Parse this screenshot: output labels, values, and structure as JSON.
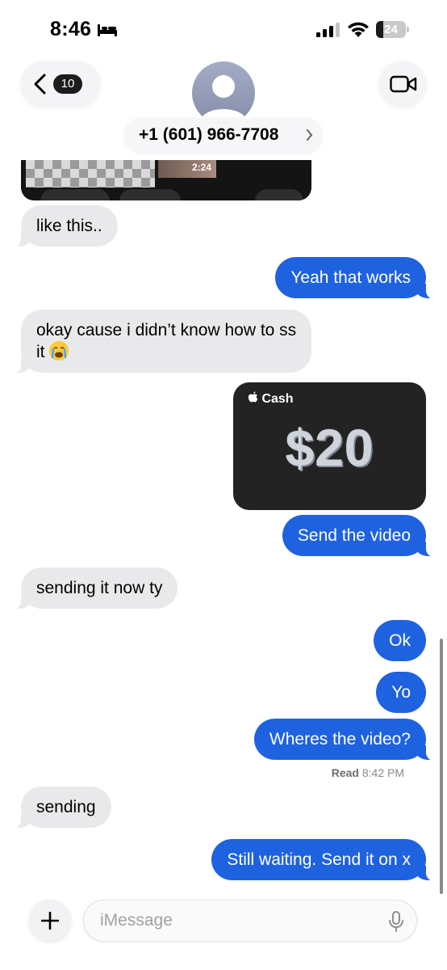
{
  "status_bar": {
    "time": "8:46",
    "battery_level": "24",
    "battery_fraction": 0.24
  },
  "header": {
    "back_count": "10",
    "contact_name": "+1 (601) 966-7708"
  },
  "media": {
    "duration": "2:24"
  },
  "messages": [
    {
      "text": "like this..",
      "direction": "incoming"
    },
    {
      "text": "Yeah that works",
      "direction": "outgoing"
    },
    {
      "line1": "okay cause i didn’t know how to ss",
      "line2": "it",
      "direction": "incoming",
      "emoji": "loudly-crying-face"
    },
    {
      "type": "apple-cash",
      "label": "Cash",
      "amount": "$20",
      "direction": "outgoing"
    },
    {
      "text": "Send the video",
      "direction": "outgoing"
    },
    {
      "text": "sending it now ty",
      "direction": "incoming"
    },
    {
      "text": "Ok",
      "direction": "outgoing"
    },
    {
      "text": "Yo",
      "direction": "outgoing"
    },
    {
      "text": "Wheres the video?",
      "direction": "outgoing"
    },
    {
      "text": "sending",
      "direction": "incoming"
    },
    {
      "text": "Still waiting. Send it on x",
      "direction": "outgoing"
    }
  ],
  "read_receipt": {
    "label": "Read",
    "time": "8:42 PM"
  },
  "compose": {
    "placeholder": "iMessage"
  },
  "colors": {
    "outgoing_bubble": "#1f62e0",
    "incoming_bubble": "#e9e9eb",
    "cash_card": "#232323"
  }
}
